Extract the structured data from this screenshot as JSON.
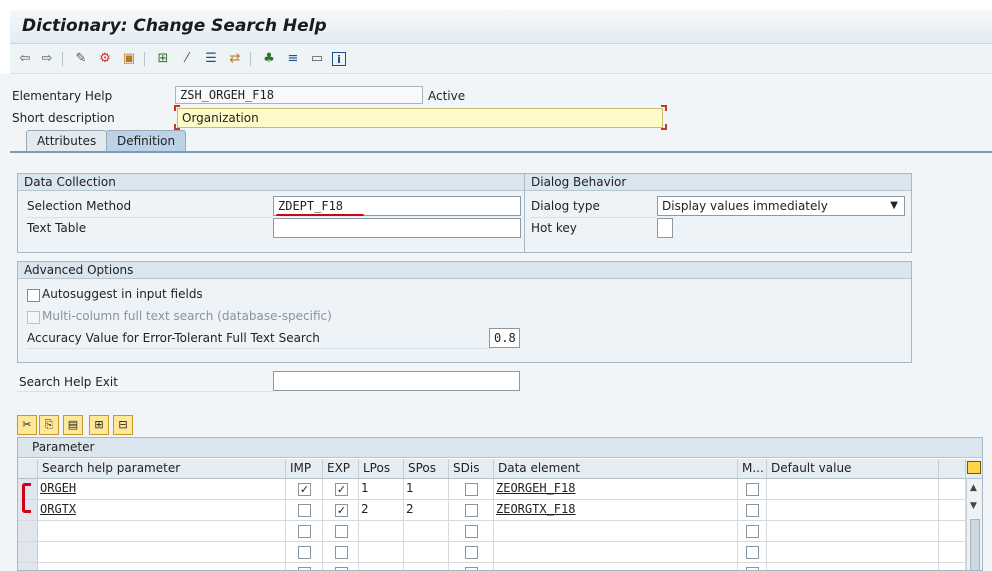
{
  "header": {
    "title": "Dictionary: Change Search Help"
  },
  "toolbar": {
    "icons": [
      "back-arrow-icon",
      "forward-arrow-icon",
      "display-change-icon",
      "other-object-icon",
      "activate-icon",
      "where-used-icon",
      "magic-wand-icon",
      "object-list-icon",
      "navigation-icon",
      "hierarchy-icon",
      "align-icon",
      "layout-icon",
      "info-icon"
    ]
  },
  "header_fields": {
    "elementary_help_label": "Elementary Help",
    "elementary_help_value": "ZSH_ORGEH_F18",
    "status": "Active",
    "short_desc_label": "Short description",
    "short_desc_value": "Organization"
  },
  "tabs": [
    {
      "label": "Attributes",
      "active": false
    },
    {
      "label": "Definition",
      "active": true
    }
  ],
  "data_collection": {
    "title": "Data Collection",
    "selection_method_label": "Selection Method",
    "selection_method_value": "ZDEPT_F18",
    "text_table_label": "Text Table",
    "text_table_value": ""
  },
  "dialog_behavior": {
    "title": "Dialog Behavior",
    "dialog_type_label": "Dialog type",
    "dialog_type_value": "Display values immediately",
    "hot_key_label": "Hot key",
    "hot_key_value": ""
  },
  "advanced_options": {
    "title": "Advanced Options",
    "autosuggest_label": "Autosuggest in input fields",
    "multicolumn_label": "Multi-column full text search (database-specific)",
    "accuracy_label": "Accuracy Value for Error-Tolerant Full Text Search",
    "accuracy_value": "0.8"
  },
  "search_help_exit": {
    "label": "Search Help Exit",
    "value": ""
  },
  "parameter_table": {
    "title": "Parameter",
    "columns": [
      "Search help parameter",
      "IMP",
      "EXP",
      "LPos",
      "SPos",
      "SDis",
      "Data element",
      "M...",
      "Default value"
    ],
    "rows": [
      {
        "param": "ORGEH",
        "imp": true,
        "exp": true,
        "lpos": "1",
        "spos": "1",
        "sdis": false,
        "data_element": "ZEORGEH_F18",
        "m": false,
        "default": ""
      },
      {
        "param": "ORGTX",
        "imp": false,
        "exp": true,
        "lpos": "2",
        "spos": "2",
        "sdis": false,
        "data_element": "ZEORGTX_F18",
        "m": false,
        "default": ""
      },
      {
        "param": "",
        "imp": false,
        "exp": false,
        "lpos": "",
        "spos": "",
        "sdis": false,
        "data_element": "",
        "m": false,
        "default": ""
      },
      {
        "param": "",
        "imp": false,
        "exp": false,
        "lpos": "",
        "spos": "",
        "sdis": false,
        "data_element": "",
        "m": false,
        "default": ""
      },
      {
        "param": "",
        "imp": false,
        "exp": false,
        "lpos": "",
        "spos": "",
        "sdis": false,
        "data_element": "",
        "m": false,
        "default": ""
      }
    ]
  },
  "colors": {
    "accent": "#7a9cb9",
    "required_bg": "#fffbc8",
    "annotation_red": "#d0021b"
  }
}
